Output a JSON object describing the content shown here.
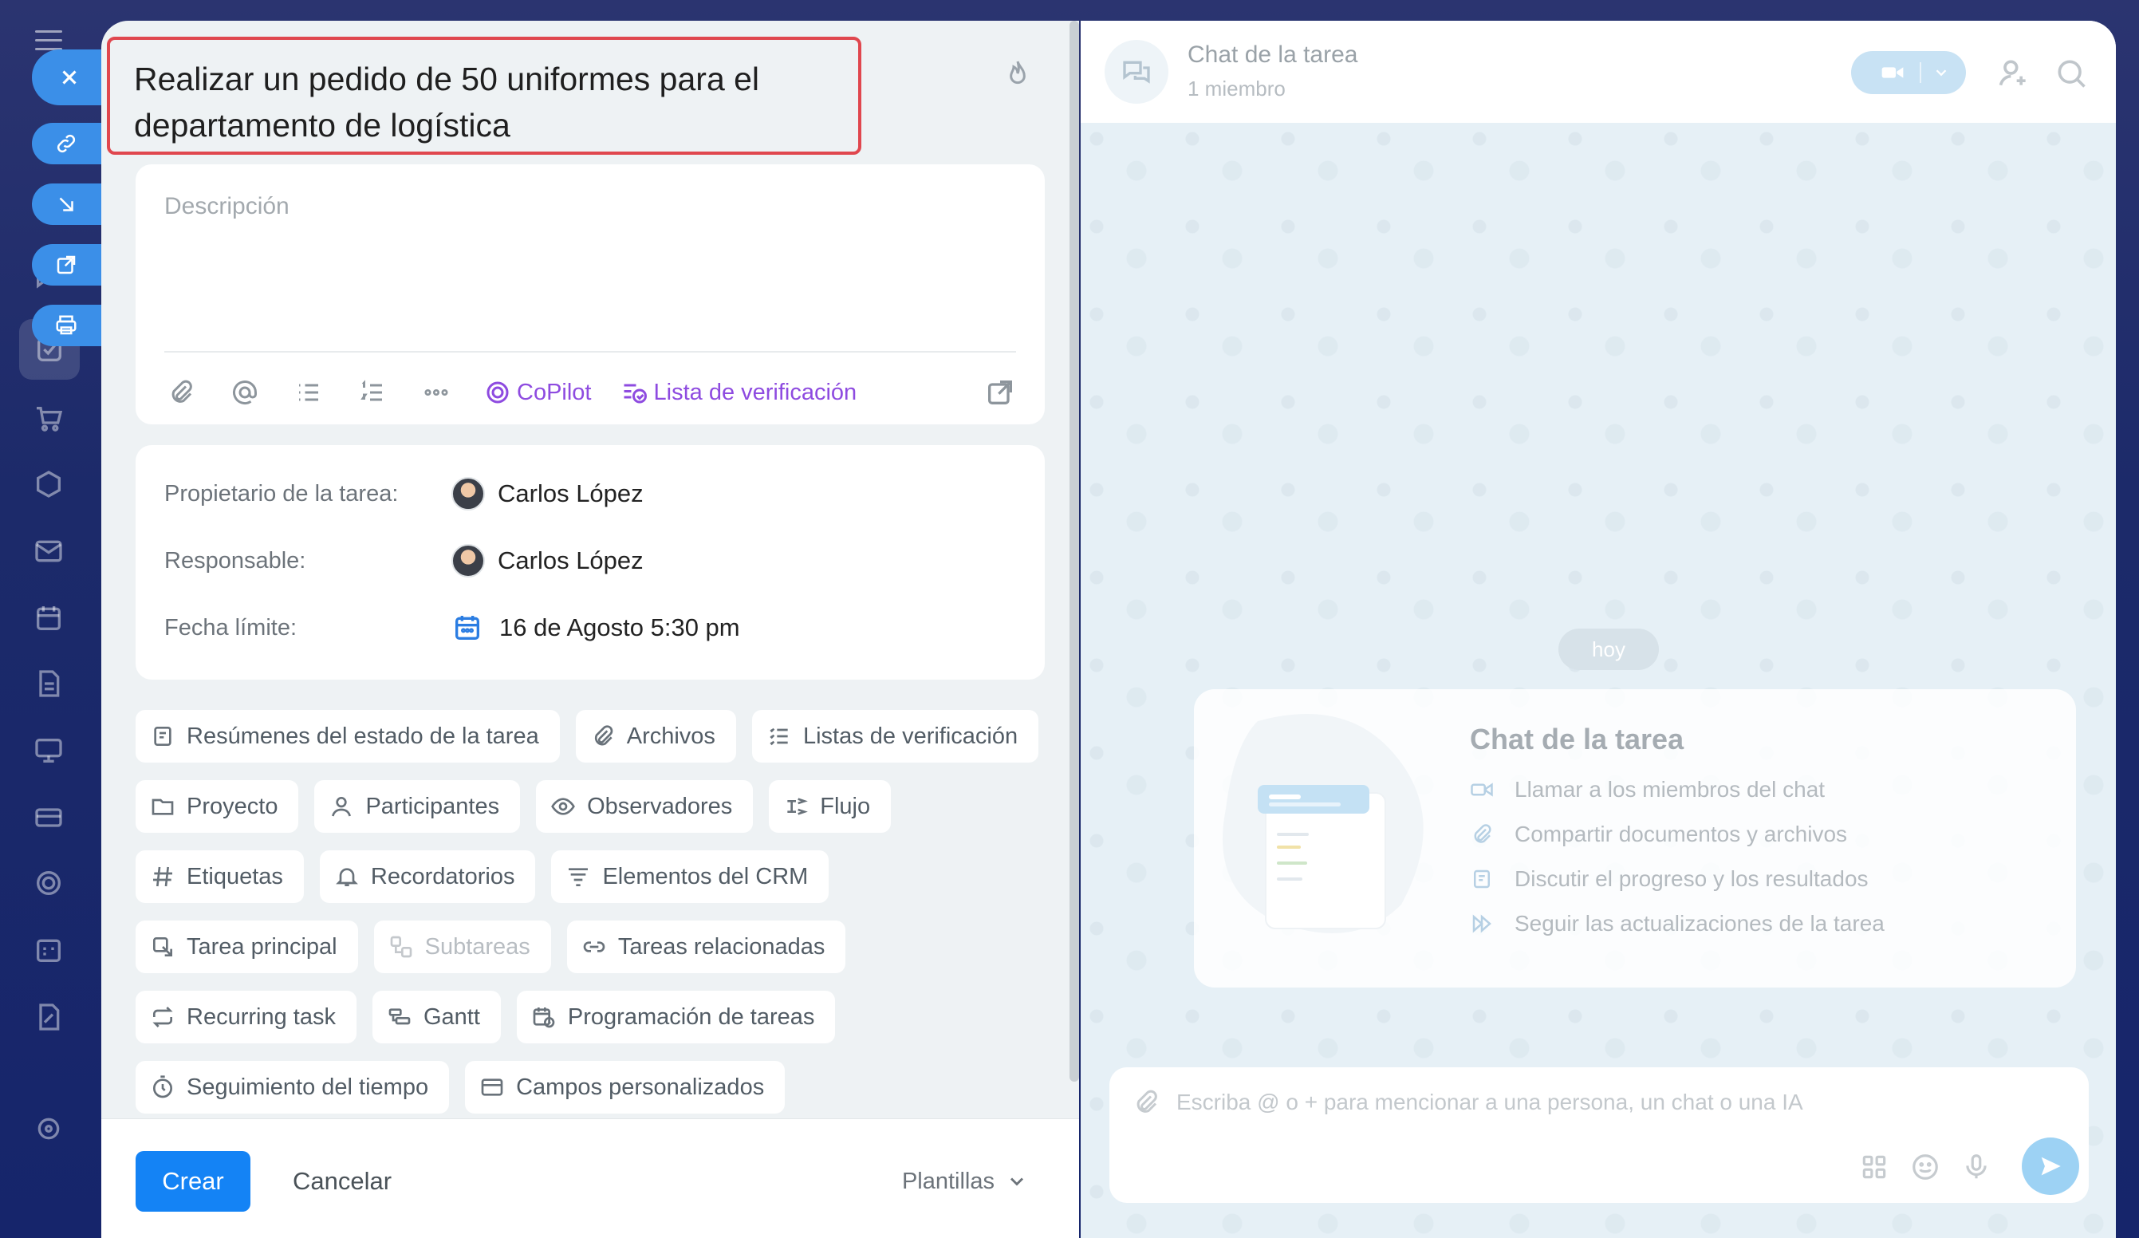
{
  "task": {
    "title": "Realizar un pedido de 50 uniformes para el departamento de logística",
    "description_placeholder": "Descripción"
  },
  "editor_toolbar": {
    "copilot_label": "CoPilot",
    "checklist_label": "Lista de verificación"
  },
  "meta": {
    "owner_label": "Propietario de la tarea:",
    "owner_name": "Carlos López",
    "responsible_label": "Responsable:",
    "responsible_name": "Carlos López",
    "deadline_label": "Fecha límite:",
    "deadline_value": "16 de Agosto 5:30 pm"
  },
  "chips": [
    [
      "Resúmenes del estado de la tarea",
      "Archivos",
      "Listas de verificación"
    ],
    [
      "Proyecto",
      "Participantes",
      "Observadores",
      "Flujo"
    ],
    [
      "Etiquetas",
      "Recordatorios",
      "Elementos del CRM"
    ],
    [
      "Tarea principal",
      "Subtareas",
      "Tareas relacionadas"
    ],
    [
      "Recurring task",
      "Gantt",
      "Programación de tareas"
    ],
    [
      "Seguimiento del tiempo",
      "Campos personalizados"
    ]
  ],
  "footer": {
    "create_label": "Crear",
    "cancel_label": "Cancelar",
    "templates_label": "Plantillas"
  },
  "chat": {
    "title": "Chat de la tarea",
    "subtitle": "1 miembro",
    "today_label": "hoy",
    "welcome_title": "Chat de la tarea",
    "welcome_items": [
      "Llamar a los miembros del chat",
      "Compartir documentos y archivos",
      "Discutir el progreso y los resultados",
      "Seguir las actualizaciones de la tarea"
    ],
    "input_placeholder": "Escriba @ o + para mencionar a una persona, un chat o una IA"
  },
  "colors": {
    "accent": "#1483f5",
    "highlight_border": "#e0474e",
    "copilot": "#8e4be0",
    "sidebar_bg": "#1c2a6a"
  }
}
